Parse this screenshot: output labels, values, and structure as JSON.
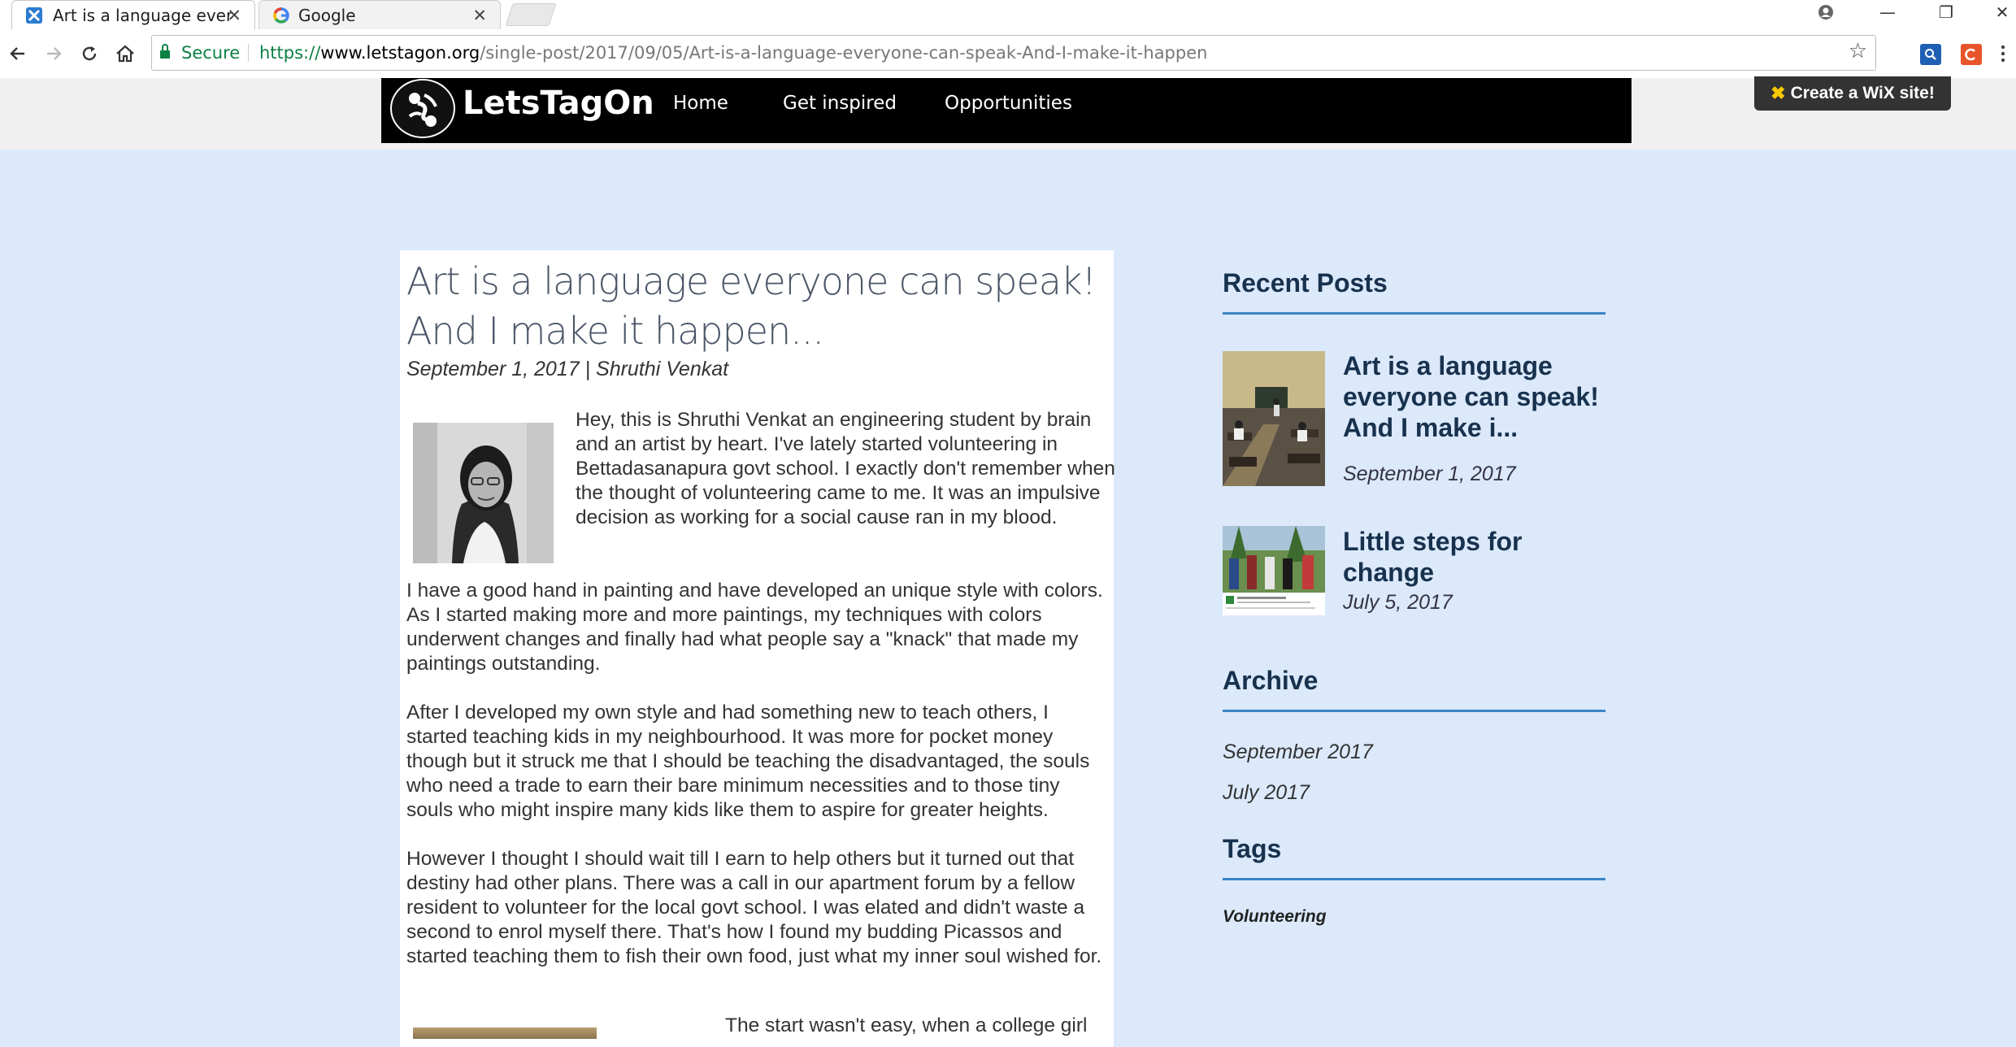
{
  "browser": {
    "tabs": [
      {
        "title": "Art is a language everyone can speak! And I make it happen",
        "active": true
      },
      {
        "title": "Google",
        "active": false
      }
    ],
    "secure_label": "Secure",
    "url": {
      "scheme": "https://",
      "host": "www.letstagon.org",
      "path": "/single-post/2017/09/05/Art-is-a-language-everyone-can-speak-And-I-make-it-happen"
    },
    "window_controls": {
      "minimize": "—",
      "restore": "❐",
      "close": "✕"
    },
    "close_glyph": "✕"
  },
  "site": {
    "logo_text": "LetsTagOn",
    "nav": [
      "Home",
      "Get inspired",
      "Opportunities"
    ],
    "wix_badge": "Create a WiX site!",
    "wix_badge_icon": "✖"
  },
  "post": {
    "title": "Art is a language everyone can speak! And I make it happen...",
    "meta": "September 1, 2017  | Shruthi Venkat",
    "paragraphs": [
      "Hey, this is Shruthi Venkat an engineering student by brain and an artist by heart. I've lately started volunteering in Bettadasanapura govt school. I exactly don't remember when the thought of volunteering came to me. It was an impulsive decision as working for a social cause ran in my blood.",
      "I have a good hand in painting and have developed an unique style with colors. As I started making more and more paintings, my techniques with colors underwent changes and finally had what people say a \"knack\" that made my paintings outstanding.",
      "After I developed my own style and had something new to teach others, I started teaching kids in my neighbourhood. It was more for pocket money though but it struck me that I should be teaching the disadvantaged, the souls who need a trade to earn their bare minimum necessities and to those tiny souls who might inspire many kids like them to aspire for greater heights.",
      "However I thought I should wait till I earn to help others but it turned out that destiny had other plans. There was a call in our apartment forum by a fellow resident to volunteer for the local govt school. I was elated and didn't waste a second to enrol myself there. That's how I found my budding Picassos and started teaching them to fish their own food, just what my inner soul wished for.",
      "The start wasn't easy, when a college girl"
    ]
  },
  "sidebar": {
    "recent_heading": "Recent Posts",
    "recent_posts": [
      {
        "title": "Art is a language everyone can speak! And I make i...",
        "date": "September 1, 2017"
      },
      {
        "title": "Little steps for change",
        "date": "July 5, 2017"
      }
    ],
    "archive_heading": "Archive",
    "archive": [
      "September 2017",
      "July 2017"
    ],
    "tags_heading": "Tags",
    "tags": [
      "Volunteering"
    ]
  },
  "colors": {
    "page_bg": "#dbe9fb",
    "header_bg": "#000000",
    "sidebar_heading": "#18324e",
    "rule": "#3a85c5",
    "secure_green": "#0b8043"
  }
}
